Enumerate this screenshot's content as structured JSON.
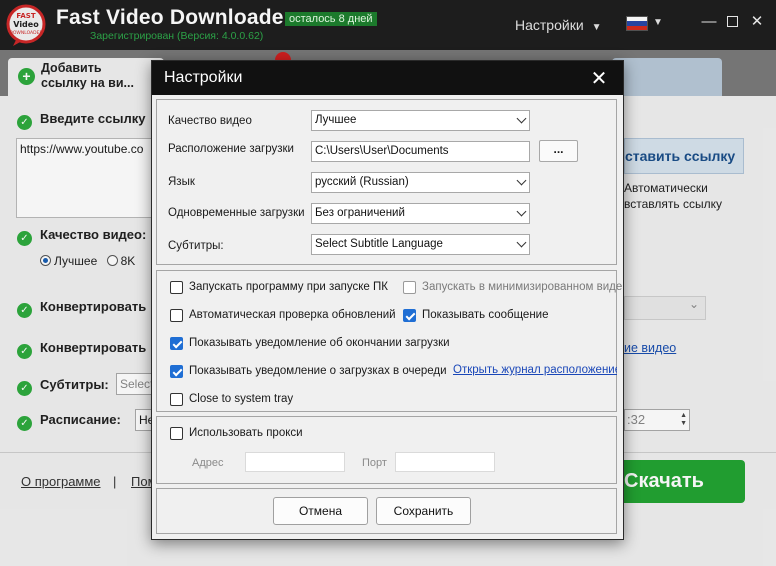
{
  "app": {
    "title": "Fast Video Downloader",
    "trial_badge": "осталось 8 дней",
    "registration": "Зарегистрирован (Версия: 4.0.0.62)",
    "settings_menu": "Настройки",
    "logo_text": "FAST Video DOWNLOADER",
    "colors": {
      "titlebar": "#1f1f1f",
      "accent_green": "#23a432",
      "link": "#1a47b8",
      "checkbox_on": "#1f6ed4"
    }
  },
  "background": {
    "tab_add_label_line1": "Добавить",
    "tab_add_label_line2": "ссылку  на ви...",
    "enter_link": "Введите ссылку",
    "url_value": "https://www.youtube.co",
    "quality_label": "Качество видео:",
    "quality_options": [
      "Лучшее",
      "8K"
    ],
    "convert1": "Конвертировать",
    "convert2": "Конвертировать",
    "subtitles_label": "Субтитры:",
    "subtitles_value": "Select",
    "schedule_label": "Расписание:",
    "schedule_value": "Не",
    "paste_link_button": "ставить ссылку",
    "auto_paste_line1": "Автоматически",
    "auto_paste_line2": "вставлять ссылку",
    "video_link": "ие видео",
    "time_value": ":32",
    "about_link": "О программе",
    "footer_separator": "|",
    "help_link": "Пом",
    "download_button": "Скачать"
  },
  "dialog": {
    "title": "Настройки",
    "close_icon": "close-icon",
    "fields": {
      "quality_label": "Качество видео",
      "quality_value": "Лучшее",
      "location_label": "Расположение загрузки",
      "location_value": "C:\\Users\\User\\Documents",
      "browse_label": "...",
      "language_label": "Язык",
      "language_value": "русский (Russian)",
      "concurrent_label": "Одновременные загрузки",
      "concurrent_value": "Без ограничений",
      "subtitles_label": "Субтитры:",
      "subtitles_value": "Select Subtitle Language"
    },
    "checkboxes": {
      "startup": {
        "label": "Запускать программу при запуске ПК",
        "checked": false
      },
      "minimized": {
        "label": "Запускать в минимизированном виде",
        "checked": false,
        "disabled": true
      },
      "auto_update": {
        "label": "Автоматическая проверка обновлений",
        "checked": false
      },
      "show_message": {
        "label": "Показывать сообщение",
        "checked": true
      },
      "notify_finish": {
        "label": "Показывать уведомление об окончании загрузки",
        "checked": true
      },
      "notify_queue": {
        "label": "Показывать уведомление о загрузках в очереди",
        "checked": true
      },
      "tray": {
        "label": "Close to system tray",
        "checked": false
      }
    },
    "journal_link": "Открыть журнал расположение",
    "proxy": {
      "use_label": "Использовать прокси",
      "checked": false,
      "address_label": "Адрес",
      "address_value": "",
      "port_label": "Порт",
      "port_value": ""
    },
    "buttons": {
      "cancel": "Отмена",
      "save": "Сохранить"
    }
  }
}
